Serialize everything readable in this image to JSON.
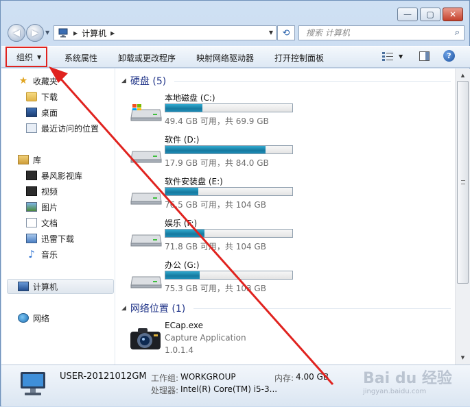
{
  "window": {
    "controls": {
      "minimize": "—",
      "maximize": "▢",
      "close": "✕"
    }
  },
  "nav": {
    "back": "◀",
    "forward": "▶",
    "history": "▼",
    "address_root_arrow": "▶",
    "address_location": "计算机",
    "address_after_arrow": "▶",
    "address_dropdown": "▼",
    "refresh": "⟲"
  },
  "search": {
    "placeholder": "搜索 计算机"
  },
  "toolbar": {
    "organize": "组织",
    "organize_caret": "▼",
    "system_properties": "系统属性",
    "uninstall": "卸载或更改程序",
    "map_drive": "映射网络驱动器",
    "control_panel": "打开控制面板",
    "view_caret": "▼",
    "help": "?"
  },
  "sidebar": {
    "favorites": {
      "label": "收藏夹",
      "items": [
        {
          "label": "下载",
          "icon": "downloads-folder-icon"
        },
        {
          "label": "桌面",
          "icon": "desktop-icon"
        },
        {
          "label": "最近访问的位置",
          "icon": "recent-places-icon"
        }
      ]
    },
    "libraries": {
      "label": "库",
      "items": [
        {
          "label": "暴风影视库",
          "icon": "video-library-icon"
        },
        {
          "label": "视频",
          "icon": "videos-icon"
        },
        {
          "label": "图片",
          "icon": "pictures-icon"
        },
        {
          "label": "文档",
          "icon": "documents-icon"
        },
        {
          "label": "迅雷下载",
          "icon": "thunder-download-icon"
        },
        {
          "label": "音乐",
          "icon": "music-icon"
        }
      ]
    },
    "computer": {
      "label": "计算机"
    },
    "network": {
      "label": "网络"
    }
  },
  "main": {
    "hard_disks": {
      "title": "硬盘 (5)",
      "drives": [
        {
          "name": "本地磁盘 (C:)",
          "size": "49.4 GB 可用，共 69.9 GB",
          "used_fraction": 0.29
        },
        {
          "name": "软件 (D:)",
          "size": "17.9 GB 可用，共 84.0 GB",
          "used_fraction": 0.79
        },
        {
          "name": "软件安装盘 (E:)",
          "size": "76.5 GB 可用，共 104 GB",
          "used_fraction": 0.26
        },
        {
          "name": "娱乐 (F:)",
          "size": "71.8 GB 可用，共 104 GB",
          "used_fraction": 0.31
        },
        {
          "name": "办公 (G:)",
          "size": "75.3 GB 可用，共 103 GB",
          "used_fraction": 0.27
        }
      ]
    },
    "network_locations": {
      "title": "网络位置 (1)",
      "items": [
        {
          "name": "ECap.exe",
          "description": "Capture Application",
          "version": "1.0.1.4"
        }
      ]
    }
  },
  "details": {
    "computer_name": "USER-20121012GM",
    "workgroup_label": "工作组:",
    "workgroup_value": "WORKGROUP",
    "memory_label": "内存:",
    "memory_value": "4.00 GB",
    "processor_label": "处理器:",
    "processor_value": "Intel(R) Core(TM) i5-3..."
  },
  "watermark": {
    "main": "Bai du 经验",
    "sub": "jingyan.baidu.com"
  },
  "colors": {
    "accent": "#1e3287",
    "drive_fill": "#1e8eb8",
    "annotation": "#e0231f"
  }
}
